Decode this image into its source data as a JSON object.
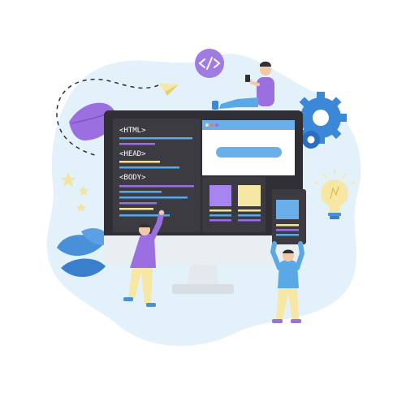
{
  "code": {
    "html_tag": "<HTML>",
    "head_tag": "<HEAD>",
    "body_tag": "<BODY>"
  },
  "colors": {
    "blob": "#e3f1fb",
    "monitor_frame": "#2f2f35",
    "code_panel": "#3b3b41",
    "accent_blue": "#5aa9e6",
    "purple": "#9b6fe0",
    "yellow": "#f4e39c",
    "gear": "#3b88d9"
  },
  "icons": {
    "badge": "code-brackets-icon",
    "plane": "paper-plane-icon",
    "gear": "gear-icon",
    "bulb": "lightbulb-icon"
  }
}
